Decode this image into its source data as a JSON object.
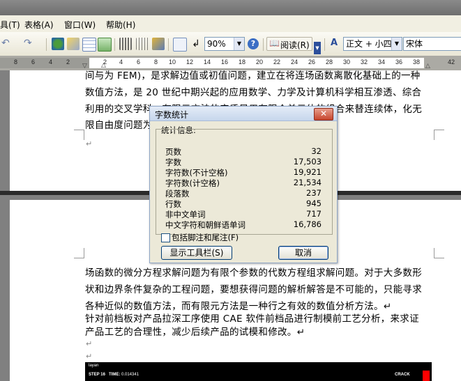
{
  "menubar": {
    "items": [
      "具(T)",
      "表格(A)",
      "窗口(W)",
      "帮助(H)"
    ]
  },
  "toolbar": {
    "zoom": "90%",
    "read_label": "阅读(R)",
    "style_value": "正文 + 小四",
    "font_value": "宋体"
  },
  "ruler": {
    "ticks": [
      "8",
      "6",
      "4",
      "2",
      "2",
      "4",
      "6",
      "8",
      "10",
      "12",
      "14",
      "16",
      "18",
      "20",
      "22",
      "24",
      "26",
      "28",
      "30",
      "32",
      "34",
      "36",
      "38",
      "42"
    ]
  },
  "document": {
    "page1_lines": [
      "间与为 FEM)，是求解边值或初值问题，建立在将连场函数离散化基础上的一种",
      "数值方法，是 20 世纪中期兴起的应用数学、力学及计算机科学相互渗透、综合",
      "利用的交叉学科。有限元方法的实质是用有限个单元体的组合来替连续体，化无",
      "限自由度问题为                                                        替一个连续域，化连续"
    ],
    "page2_lines": [
      "场函数的微分方程求解问题为有限个参数的代数方程组求解问题。对于大多数形",
      "状和边界条件复杂的工程问题，要想获得问题的解析解答是不可能的，只能寻求",
      "各种近似的数值方法，而有限元方法是一种行之有效的数值分析方法。↵",
      "针对前档板对产品拉深工序使用 CAE 软件前档品进行制模前工艺分析，来求证",
      "产品工艺的合理性，减少后续产品的试模和修改。↵"
    ],
    "image_strip": {
      "label": "layan",
      "step": "STEP 16",
      "time_label": "TIME:",
      "time_value": "0.014341",
      "crack": "CRACK"
    }
  },
  "dialog": {
    "title": "字数统计",
    "group_label": "统计信息:",
    "stats": [
      {
        "label": "页数",
        "value": "32"
      },
      {
        "label": "字数",
        "value": "17,503"
      },
      {
        "label": "字符数(不计空格)",
        "value": "19,921"
      },
      {
        "label": "字符数(计空格)",
        "value": "21,534"
      },
      {
        "label": "段落数",
        "value": "237"
      },
      {
        "label": "行数",
        "value": "945"
      },
      {
        "label": "非中文单词",
        "value": "717"
      },
      {
        "label": "中文字符和朝鲜语单词",
        "value": "16,786"
      }
    ],
    "checkbox_label": "包括脚注和尾注(F)",
    "show_toolbar_button": "显示工具栏(S)",
    "cancel_button": "取消"
  },
  "colors": {
    "accent": "#ff0000",
    "dialog_bg": "#ece9d8",
    "close_button": "#c6452c"
  }
}
